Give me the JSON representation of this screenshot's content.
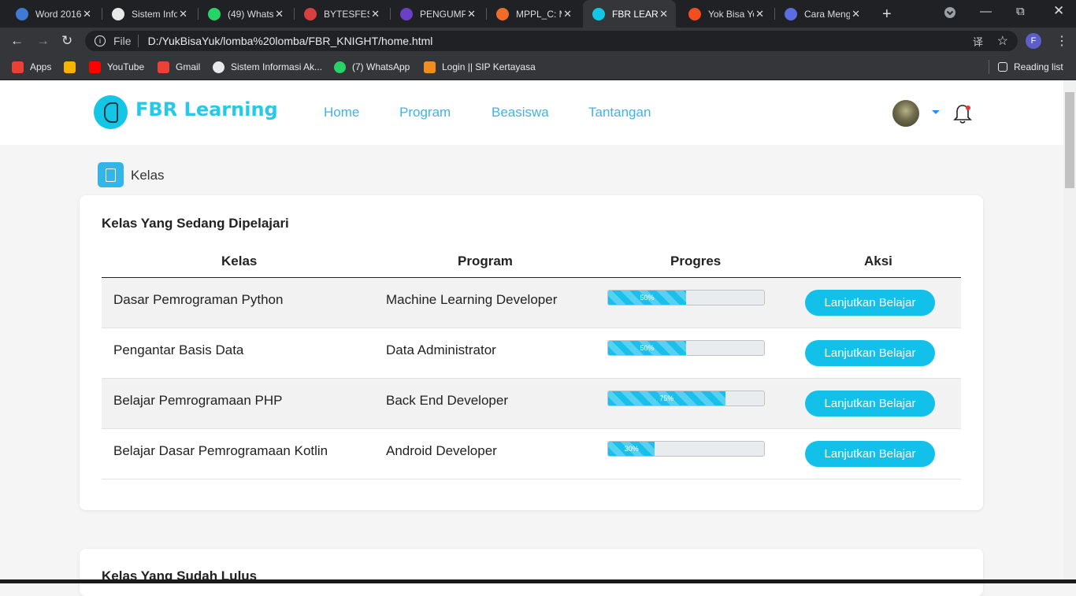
{
  "browser": {
    "tabs": [
      {
        "title": "Word 2016",
        "color": "#3f7bd4"
      },
      {
        "title": "Sistem Info",
        "color": "#e9e9e9"
      },
      {
        "title": "(49) Whats",
        "color": "#25d366"
      },
      {
        "title": "BYTESFEST",
        "color": "#d93f3f"
      },
      {
        "title": "PENGUMP",
        "color": "#6c3fc7"
      },
      {
        "title": "MPPL_C: M",
        "color": "#f06c2a"
      },
      {
        "title": "FBR LEARN",
        "color": "#13c6e5"
      },
      {
        "title": "Yok Bisa Yo",
        "color": "#f24e1e"
      },
      {
        "title": "Cara Meng",
        "color": "#5b6ee1"
      }
    ],
    "url_prefix": "File",
    "url": "D:/YukBisaYuk/lomba%20lomba/FBR_KNIGHT/home.html",
    "profile_letter": "F",
    "bookmarks": [
      {
        "label": "Apps",
        "color": "#e94235"
      },
      {
        "label": "",
        "color": "#f4b400"
      },
      {
        "label": "YouTube",
        "color": "#ff0000"
      },
      {
        "label": "Gmail",
        "color": "#ea4335"
      },
      {
        "label": "Sistem Informasi Ak...",
        "color": "#e9e9e9"
      },
      {
        "label": "(7) WhatsApp",
        "color": "#25d366"
      },
      {
        "label": "Login || SIP Kertayasa",
        "color": "#f28b20"
      }
    ],
    "reading_list": "Reading list"
  },
  "site": {
    "brand": "FBR Learning",
    "nav": [
      "Home",
      "Program",
      "Beasiswa",
      "Tantangan"
    ]
  },
  "section": {
    "title": "Kelas"
  },
  "table": {
    "title": "Kelas Yang Sedang Dipelajari",
    "headers": [
      "Kelas",
      "Program",
      "Progres",
      "Aksi"
    ],
    "rows": [
      {
        "kelas": "Dasar Pemrograman Python",
        "program": "Machine Learning Developer",
        "progress": 50,
        "progress_label": "50%",
        "action": "Lanjutkan Belajar"
      },
      {
        "kelas": "Pengantar Basis Data",
        "program": "Data Administrator",
        "progress": 50,
        "progress_label": "50%",
        "action": "Lanjutkan Belajar"
      },
      {
        "kelas": "Belajar Pemrogramaan PHP",
        "program": "Back End Developer",
        "progress": 75,
        "progress_label": "75%",
        "action": "Lanjutkan Belajar"
      },
      {
        "kelas": "Belajar Dasar Pemrogramaan Kotlin",
        "program": "Android Developer",
        "progress": 30,
        "progress_label": "30%",
        "action": "Lanjutkan Belajar"
      }
    ]
  },
  "table2": {
    "title": "Kelas Yang Sudah Lulus"
  },
  "colors": {
    "accent": "#13c6e5",
    "nav": "#43b2e4"
  }
}
